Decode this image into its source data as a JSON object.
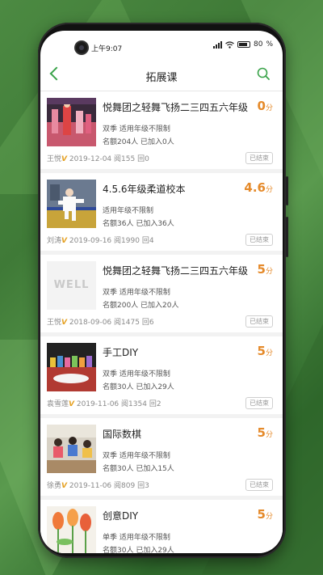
{
  "status_bar": {
    "time": "上午9:07",
    "battery_percent": "80"
  },
  "header": {
    "title": "拓展课",
    "back_icon": "chevron-left-icon",
    "search_icon": "search-icon"
  },
  "colors": {
    "accent_green": "#3aa34a",
    "score_orange": "#e58a2a",
    "verified_gold": "#e5a123"
  },
  "courses": [
    {
      "name": "悦舞团之轻舞飞扬二三四五六年级",
      "score": "0",
      "unit": "分",
      "line1": "双季 适用年级不限制",
      "line2": "名额204人 已加入0人",
      "author": "王悦",
      "verified": "V",
      "date": "2019-12-04",
      "views": "阅155",
      "replies": "回0",
      "status": "已结束",
      "thumb": "dance-photo"
    },
    {
      "name": "4.5.6年级柔道校本",
      "score": "4.6",
      "unit": "分",
      "line1": "适用年级不限制",
      "line2": "名额36人 已加入36人",
      "author": "刘涛",
      "verified": "V",
      "date": "2019-09-16",
      "views": "阅1990",
      "replies": "回4",
      "status": "已结束",
      "thumb": "judo-photo"
    },
    {
      "name": "悦舞团之轻舞飞扬二三四五六年级",
      "score": "5",
      "unit": "分",
      "line1": "双季 适用年级不限制",
      "line2": "名额200人 已加入20人",
      "author": "王悦",
      "verified": "V",
      "date": "2018-09-06",
      "views": "阅1475",
      "replies": "回6",
      "status": "已结束",
      "thumb": "well-logo",
      "thumb_text": "WELL"
    },
    {
      "name": "手工DIY",
      "score": "5",
      "unit": "分",
      "line1": "双季 适用年级不限制",
      "line2": "名额30人 已加入29人",
      "author": "袁雪莲",
      "verified": "V",
      "date": "2019-11-06",
      "views": "阅1354",
      "replies": "回2",
      "status": "已结束",
      "thumb": "crafts-photo"
    },
    {
      "name": "国际数棋",
      "score": "5",
      "unit": "分",
      "line1": "双季 适用年级不限制",
      "line2": "名额30人 已加入15人",
      "author": "徐勇",
      "verified": "V",
      "date": "2019-11-06",
      "views": "阅809",
      "replies": "回3",
      "status": "已结束",
      "thumb": "classroom-photo"
    },
    {
      "name": "创意DIY",
      "score": "5",
      "unit": "分",
      "line1": "单季 适用年级不限制",
      "line2": "名额30人 已加入29人",
      "thumb": "tulips-photo"
    }
  ]
}
